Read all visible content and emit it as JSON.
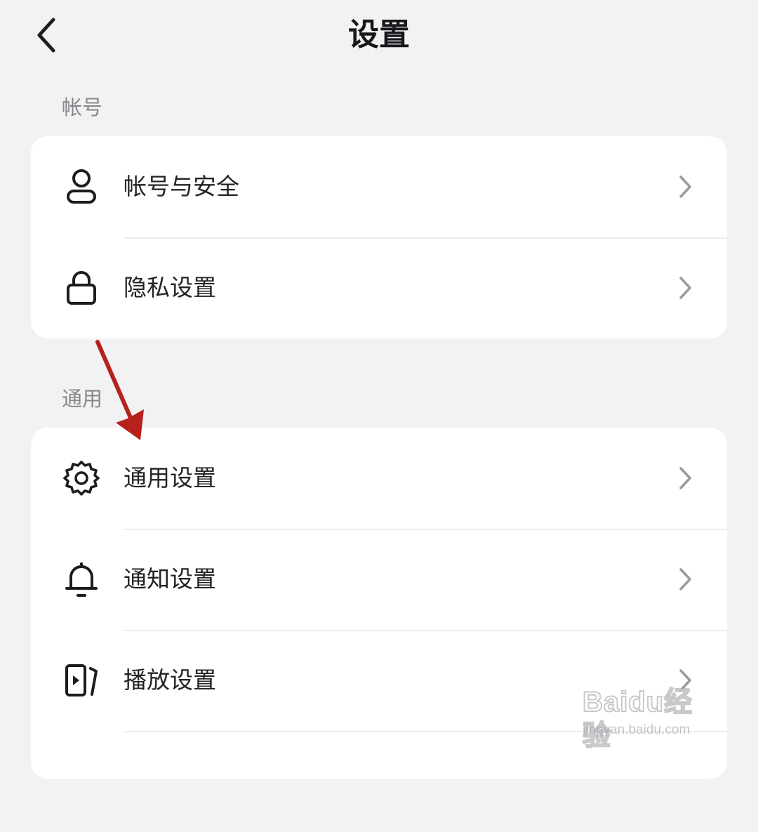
{
  "header": {
    "title": "设置",
    "back_icon": "chevron-left-icon"
  },
  "sections": [
    {
      "label": "帐号",
      "items": [
        {
          "label": "帐号与安全",
          "icon": "user-icon"
        },
        {
          "label": "隐私设置",
          "icon": "lock-icon"
        }
      ]
    },
    {
      "label": "通用",
      "items": [
        {
          "label": "通用设置",
          "icon": "gear-icon"
        },
        {
          "label": "通知设置",
          "icon": "bell-icon"
        },
        {
          "label": "播放设置",
          "icon": "play-device-icon"
        }
      ]
    }
  ],
  "annotation": {
    "color": "#b7211c",
    "points_to": "通用设置"
  },
  "watermark": {
    "brand": "Baidu经验",
    "sub": "jingyan.baidu.com"
  },
  "colors": {
    "background": "#f2f2f3",
    "card": "#ffffff",
    "text": "#222326",
    "section_label": "#86878b",
    "chevron": "#9a9b9f"
  }
}
